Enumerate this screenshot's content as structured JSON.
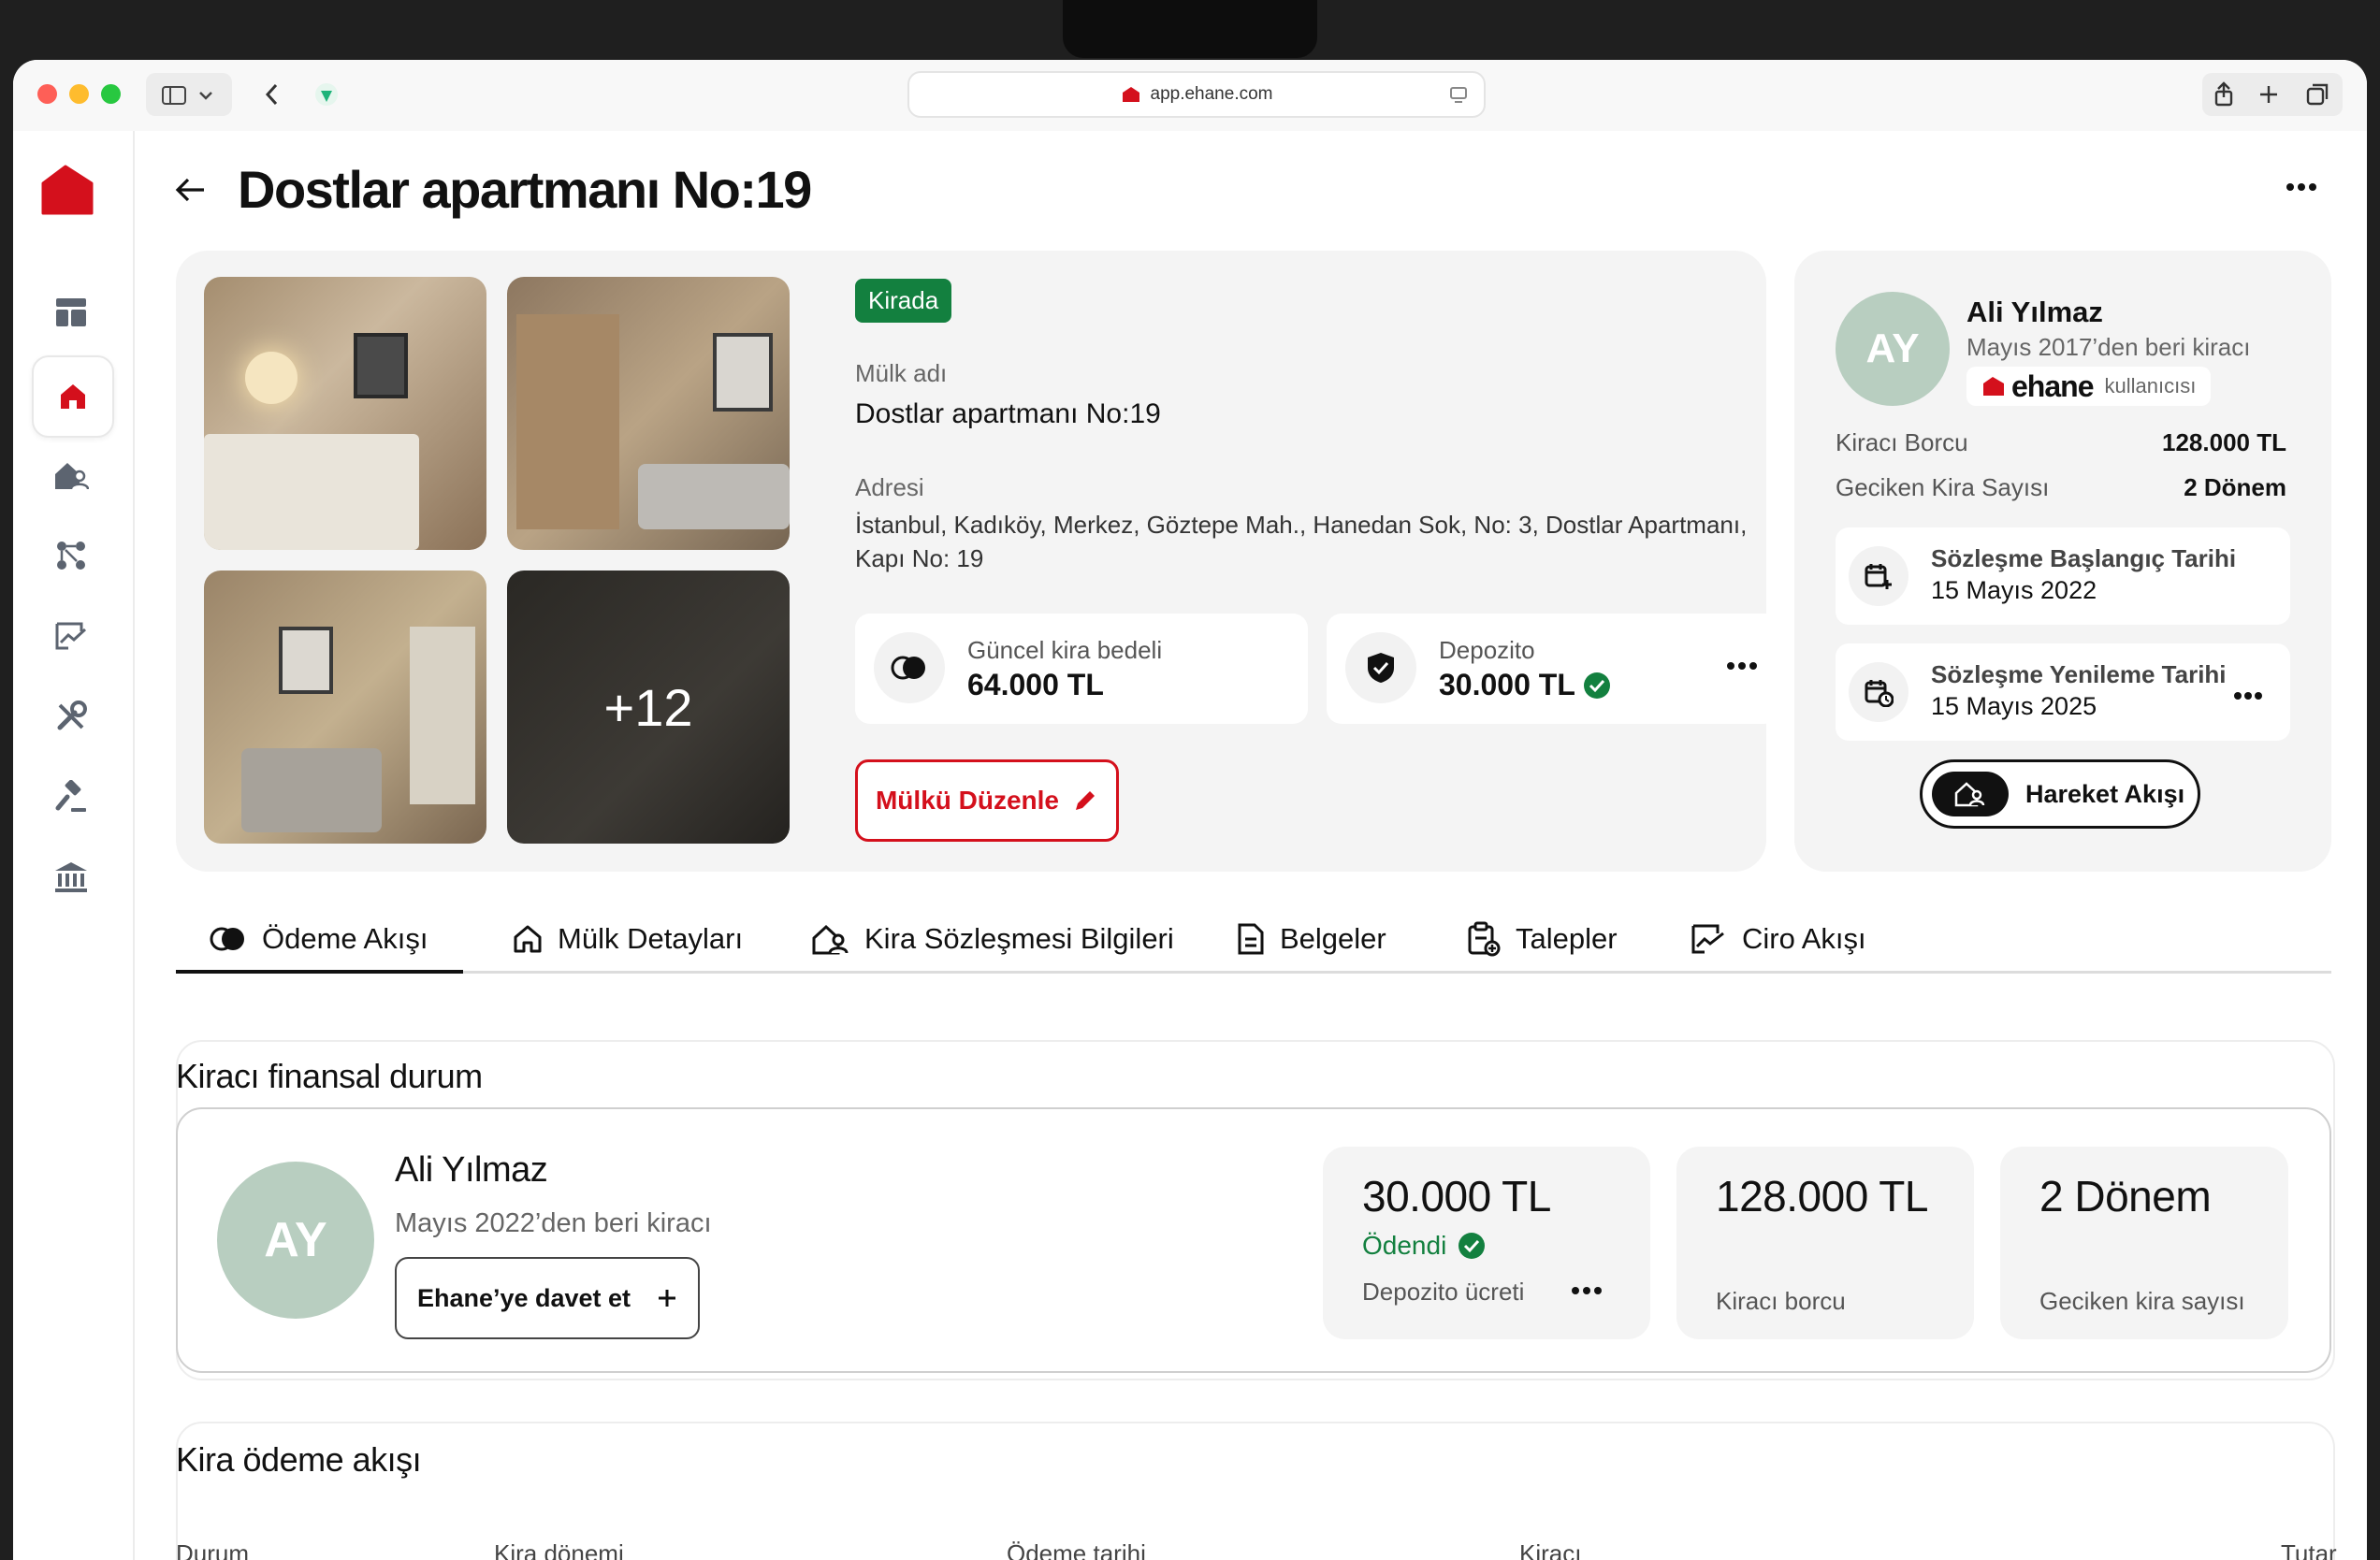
{
  "browser": {
    "url": "app.ehane.com"
  },
  "page": {
    "title": "Dostlar apartmanı No:19"
  },
  "property": {
    "status_badge": "Kirada",
    "more_photos": "+12",
    "name_label": "Mülk adı",
    "name_value": "Dostlar apartmanı No:19",
    "address_label": "Adresi",
    "address_line1": "İstanbul, Kadıköy, Merkez, Göztepe Mah., Hanedan Sok, No: 3, Dostlar Apartmanı,",
    "address_line2": "Kapı No: 19",
    "rent_label": "Güncel kira bedeli",
    "rent_value": "64.000 TL",
    "deposit_label": "Depozito",
    "deposit_value": "30.000 TL",
    "edit_button": "Mülkü Düzenle"
  },
  "tenant_panel": {
    "initials": "AY",
    "name": "Ali Yılmaz",
    "since": "Mayıs 2017’den beri kiracı",
    "brand": "ehane",
    "brand_suffix": "kullanıcısı",
    "debt_label": "Kiracı Borcu",
    "debt_value": "128.000 TL",
    "late_label": "Geciken Kira Sayısı",
    "late_value": "2 Dönem",
    "start_label": "Sözleşme Başlangıç Tarihi",
    "start_value": "15 Mayıs 2022",
    "renew_label": "Sözleşme Yenileme Tarihi",
    "renew_value": "15 Mayıs 2025",
    "flow_button": "Hareket Akışı"
  },
  "tabs": [
    {
      "label": "Ödeme Akışı"
    },
    {
      "label": "Mülk Detayları"
    },
    {
      "label": "Kira Sözleşmesi Bilgileri"
    },
    {
      "label": "Belgeler"
    },
    {
      "label": "Talepler"
    },
    {
      "label": "Ciro Akışı"
    }
  ],
  "finance": {
    "title": "Kiracı finansal durum",
    "initials": "AY",
    "name": "Ali Yılmaz",
    "since": "Mayıs 2022’den beri kiracı",
    "invite_button": "Ehane’ye davet et",
    "deposit_amount": "30.000 TL",
    "deposit_status": "Ödendi",
    "deposit_label": "Depozito ücreti",
    "debt_amount": "128.000 TL",
    "debt_label": "Kiracı borcu",
    "late_amount": "2 Dönem",
    "late_label": "Geciken kira sayısı"
  },
  "payments": {
    "title": "Kira ödeme akışı",
    "columns": [
      "Durum",
      "Kira dönemi",
      "Ödeme tarihi",
      "Kiracı",
      "Tutar"
    ]
  },
  "colors": {
    "brand_red": "#d4101c",
    "success_green": "#13803f",
    "avatar": "#b8cec0"
  },
  "icons": [
    "home-icon",
    "dashboard-icon",
    "property-user-icon",
    "flow-icon",
    "chart-icon",
    "tools-icon",
    "gavel-icon",
    "bank-icon"
  ]
}
